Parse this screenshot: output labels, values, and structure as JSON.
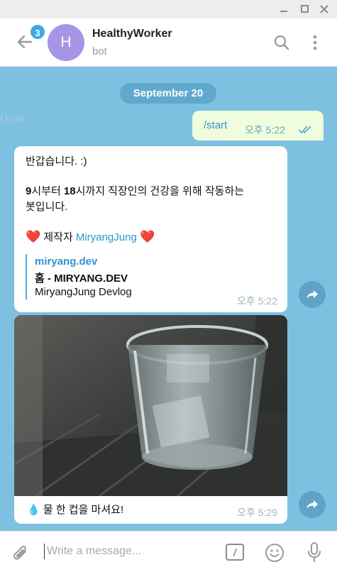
{
  "window": {
    "controls": [
      "minimize",
      "maximize",
      "close"
    ]
  },
  "header": {
    "unread_badge": "3",
    "avatar_letter": "H",
    "title": "HealthyWorker",
    "subtitle": "bot",
    "avatar_color": "#a695e7",
    "badge_color": "#3fa9e0"
  },
  "chat": {
    "background": "#7ec0e0",
    "date_pill": "September 20",
    "ghost_text": "설치(W)",
    "messages": [
      {
        "direction": "outgoing",
        "text": "/start",
        "time": "오후 5:22",
        "status": "read"
      },
      {
        "direction": "incoming",
        "line1": "반갑습니다. :)",
        "line2_part1": "9",
        "line2_part2": "시부터 ",
        "line2_part3": "18",
        "line2_part4": "시까지 직장인의 건강을 위해 작동하는",
        "line3": "봇입니다.",
        "heart": "❤️",
        "author_prefix": "제작자 ",
        "author_mention": "MiryangJung",
        "link_preview": {
          "site": "miryang.dev",
          "title": "홈 - MIRYANG.DEV",
          "description": "MiryangJung Devlog"
        },
        "time": "오후 5:22"
      },
      {
        "direction": "incoming",
        "type": "photo",
        "photo_subject": "glass of water",
        "caption_icon": "💧",
        "caption": "물 한 컵을 마셔요!",
        "time": "오후 5:29"
      }
    ]
  },
  "composer": {
    "placeholder": "Write a message...",
    "command_label": "/"
  }
}
